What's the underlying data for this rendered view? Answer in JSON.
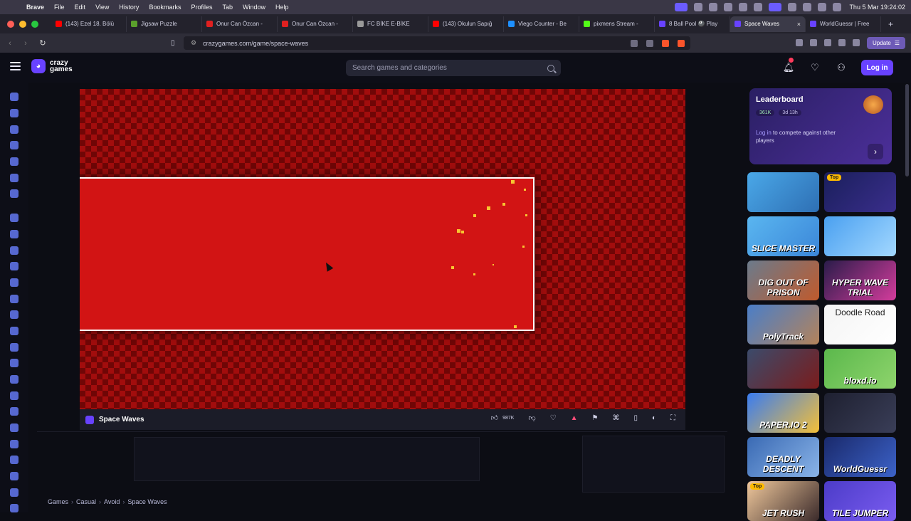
{
  "menubar": {
    "app": "Brave",
    "items": [
      "File",
      "Edit",
      "View",
      "History",
      "Bookmarks",
      "Profiles",
      "Tab",
      "Window",
      "Help"
    ],
    "clock": "Thu 5 Mar  19:24:02"
  },
  "tabs": [
    {
      "label": "(143) Ezel 18. Bölü",
      "color": "#ff0000"
    },
    {
      "label": "Jigsaw Puzzle",
      "color": "#5aa02c"
    },
    {
      "label": "Onur Can Özcan -",
      "color": "#e02020"
    },
    {
      "label": "Onur Can Özcan -",
      "color": "#e02020"
    },
    {
      "label": "FC BİKE E-BİKE",
      "color": "#999999"
    },
    {
      "label": "(143) Okulun Sapığ",
      "color": "#ff0000"
    },
    {
      "label": "Viego Counter - Be",
      "color": "#1e90ff"
    },
    {
      "label": "pixmens Stream -",
      "color": "#53fc18"
    },
    {
      "label": "8 Ball Pool 🎱 Play",
      "color": "#6842ff"
    },
    {
      "label": "Space Waves",
      "color": "#6842ff",
      "active": true
    },
    {
      "label": "WorldGuessr | Free",
      "color": "#6842ff"
    }
  ],
  "address": {
    "url": "crazygames.com/game/space-waves",
    "update_label": "Update"
  },
  "header": {
    "logo_line1": "crazy",
    "logo_line2": "games",
    "search_placeholder": "Search games and categories",
    "login_label": "Log in"
  },
  "game": {
    "title": "Space Waves",
    "likes": "987K"
  },
  "breadcrumb": [
    "Games",
    "Casual",
    "Avoid",
    "Space Waves"
  ],
  "leaderboard": {
    "title": "Leaderboard",
    "players": "361K",
    "time_left": "3d 13h",
    "login_link": "Log in",
    "text": " to compete against other players"
  },
  "thumbnails": [
    {
      "label": "",
      "colors": [
        "#4aa8e8",
        "#2e6fb4"
      ],
      "tag": ""
    },
    {
      "label": "",
      "colors": [
        "#1a1f5c",
        "#3a2e8c"
      ],
      "tag": "Top"
    },
    {
      "label": "SLICE MASTER",
      "colors": [
        "#5ab6f0",
        "#3b86d8"
      ],
      "tag": ""
    },
    {
      "label": "",
      "colors": [
        "#4aa0f0",
        "#a3d8ff"
      ],
      "tag": ""
    },
    {
      "label": "DIG OUT OF PRISON",
      "colors": [
        "#6b7b8c",
        "#c05a2c"
      ],
      "tag": ""
    },
    {
      "label": "HYPER WAVE TRIAL",
      "colors": [
        "#2a1c4a",
        "#d43c9c"
      ],
      "tag": ""
    },
    {
      "label": "PolyTrack",
      "colors": [
        "#4a7ec8",
        "#b4835a"
      ],
      "tag": ""
    },
    {
      "label": "Doodle Road",
      "colors": [
        "#f4f4f4",
        "#ffffff"
      ],
      "tag": ""
    },
    {
      "label": "",
      "colors": [
        "#3b4b6b",
        "#7a1c1c"
      ],
      "tag": ""
    },
    {
      "label": "bloxd.io",
      "colors": [
        "#5bb84c",
        "#8ed46c"
      ],
      "tag": ""
    },
    {
      "label": "PAPER.IO 2",
      "colors": [
        "#3a7cf0",
        "#f4c038"
      ],
      "tag": ""
    },
    {
      "label": "",
      "colors": [
        "#1e2030",
        "#3a3e58"
      ],
      "tag": ""
    },
    {
      "label": "DEADLY DESCENT",
      "colors": [
        "#3a6ab4",
        "#8ab4e8"
      ],
      "tag": ""
    },
    {
      "label": "WorldGuessr",
      "colors": [
        "#1a2a6c",
        "#3c62c8"
      ],
      "tag": ""
    },
    {
      "label": "JET RUSH",
      "colors": [
        "#f0c89c",
        "#3a2a2a"
      ],
      "tag": "Top"
    },
    {
      "label": "TILE JUMPER",
      "colors": [
        "#4c3cc8",
        "#7a5cf0"
      ],
      "tag": ""
    }
  ]
}
